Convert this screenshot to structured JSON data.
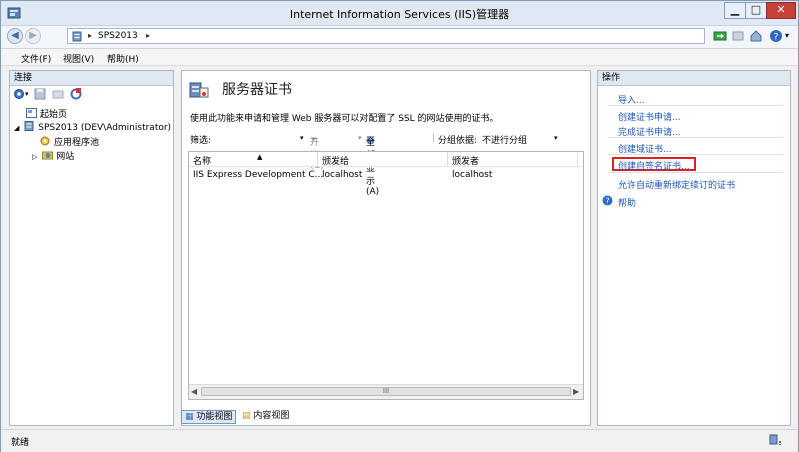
{
  "window": {
    "title": "Internet Information Services (IIS)管理器",
    "minimize_glyph": "▁",
    "maximize_glyph": "□",
    "close_glyph": "✕"
  },
  "address": {
    "breadcrumb": [
      "SPS2013"
    ],
    "separator": "▸"
  },
  "menu": [
    "文件(F)",
    "视图(V)",
    "帮助(H)"
  ],
  "connections": {
    "header": "连接",
    "tree": [
      {
        "label": "起始页",
        "level": 1
      },
      {
        "label": "SPS2013 (DEV\\Administrator)",
        "level": 0
      },
      {
        "label": "应用程序池",
        "level": 2
      },
      {
        "label": "网站",
        "level": 2
      }
    ]
  },
  "feature": {
    "title": "服务器证书",
    "description": "使用此功能来申请和管理 Web 服务器可以对配置了 SSL 的网站使用的证书。",
    "filter": {
      "label": "筛选:",
      "go": "开始(G)",
      "show_all": "全部显示(A)",
      "group_by_label": "分组依据:",
      "group_by_value": "不进行分组"
    },
    "columns": [
      "名称",
      "颁发给",
      "颁发者"
    ],
    "rows": [
      [
        "IIS Express Development C...",
        "localhost",
        "localhost"
      ]
    ],
    "scroll_thumb": "III"
  },
  "view_tabs": [
    "功能视图",
    "内容视图"
  ],
  "actions": {
    "header": "操作",
    "items": [
      "导入...",
      "创建证书申请...",
      "完成证书申请...",
      "创建域证书...",
      "创建自签名证书...",
      "允许自动重新绑定续订的证书",
      "帮助"
    ]
  },
  "status": {
    "text": "就绪"
  },
  "colors": {
    "link": "#1a56b8",
    "highlight_box": "#e02020"
  }
}
